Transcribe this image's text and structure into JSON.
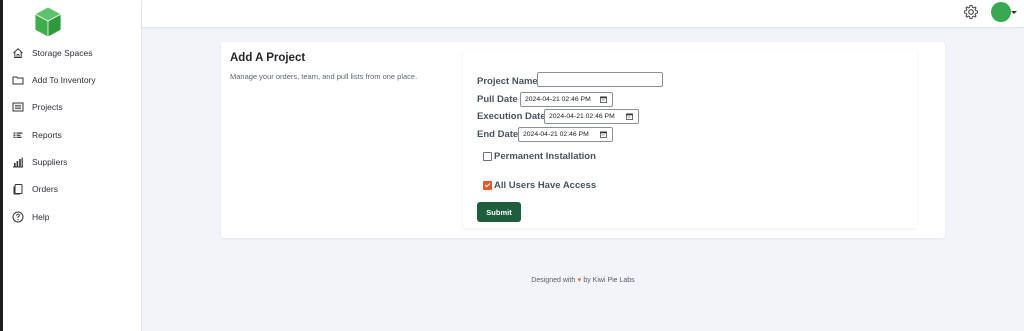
{
  "sidebar": {
    "items": [
      {
        "label": "Storage Spaces",
        "icon": "home-icon"
      },
      {
        "label": "Add To Inventory",
        "icon": "folder-icon"
      },
      {
        "label": "Projects",
        "icon": "list-icon"
      },
      {
        "label": "Reports",
        "icon": "bars-icon"
      },
      {
        "label": "Suppliers",
        "icon": "chart-icon"
      },
      {
        "label": "Orders",
        "icon": "copy-icon"
      },
      {
        "label": "Help",
        "icon": "help-icon"
      }
    ]
  },
  "header": {
    "settings_icon": "gear-icon",
    "avatar_color": "#39a853"
  },
  "card": {
    "title": "Add A Project",
    "subtitle": "Manage your orders, team, and pull lists from one place."
  },
  "form": {
    "project_name_label": "Project Name",
    "project_name_value": "",
    "pull_date_label": "Pull Date",
    "pull_date_value": "2024-04-21 02:46 PM",
    "execution_date_label": "Execution Date",
    "execution_date_value": "2024-04-21 02:46 PM",
    "end_date_label": "End Date",
    "end_date_value": "2024-04-21 02:46 PM",
    "permanent_installation_label": "Permanent Installation",
    "permanent_installation_checked": false,
    "all_users_access_label": "All Users Have Access",
    "all_users_access_checked": true,
    "submit_label": "Submit"
  },
  "footer": {
    "prefix": "Designed with",
    "heart": "♥",
    "suffix": "by Kiwi Pie Labs"
  },
  "colors": {
    "brand_green": "#3fae4a",
    "submit_bg": "#1e5e3c",
    "checkbox_accent": "#e2582b",
    "page_bg": "#f3f4f9"
  }
}
